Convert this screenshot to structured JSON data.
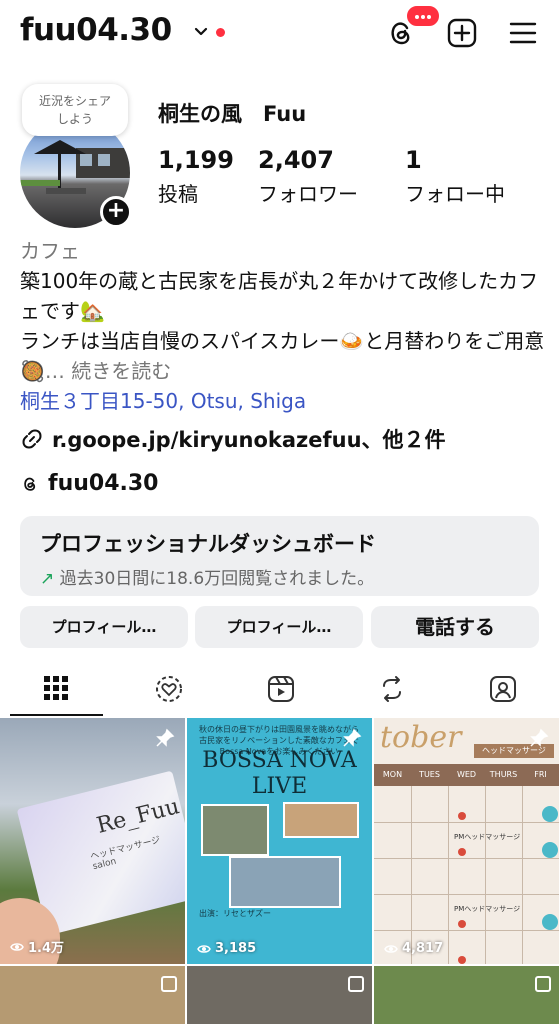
{
  "header": {
    "username": "fuu04.30",
    "icons": {
      "threads": "threads-icon",
      "create": "plus-square-icon",
      "menu": "hamburger-menu-icon"
    },
    "notification_badge": "•••"
  },
  "profile": {
    "note_bubble": "近況をシェア\nしよう",
    "display_name": "桐生の風　Fuu",
    "stats": [
      {
        "value": "1,199",
        "label": "投稿"
      },
      {
        "value": "2,407",
        "label": "フォロワー"
      },
      {
        "value": "1",
        "label": "フォロー中"
      }
    ],
    "category": "カフェ",
    "bio_line1": "築100年の蔵と古民家を店長が丸２年かけて改修したカフェです🏡",
    "bio_line2": "ランチは当店自慢のスパイスカレー🍛と月替わりをご用意🥘",
    "more": "… 続きを読む",
    "location": "桐生３丁目15-50, Otsu, Shiga",
    "link": "r.goope.jp/kiryunokazefuu、他２件",
    "threads_handle": "fuu04.30"
  },
  "dashboard": {
    "title": "プロフェッショナルダッシュボード",
    "subtitle_arrow": "↗",
    "subtitle": "過去30日間に18.6万回閲覧されました。"
  },
  "buttons": {
    "edit_profile": "プロフィール…",
    "share_profile": "プロフィール…",
    "call": "電話する"
  },
  "tabs": [
    "grid-icon",
    "reels-feed-icon",
    "reels-icon",
    "reposts-icon",
    "tagged-icon"
  ],
  "posts": [
    {
      "views": "1.4万",
      "pinned": true,
      "card_title": "Re_Fuu",
      "card_sub": "ヘッドマッサージsalon"
    },
    {
      "views": "3,185",
      "pinned": true,
      "title": "BOSSA NOVA\nLIVE",
      "top_text": "秋の休日の昼下がりは田園風景を眺めながら古民家をリノベーションした素敵なカフェでBossa Novaをお楽しみください",
      "bottom_text": "出演：リセとザズー"
    },
    {
      "views": "4,817",
      "pinned": true,
      "cal_title": "tober",
      "cal_tag": "ヘッドマッサージ",
      "days": [
        "MON",
        "TUES",
        "WED",
        "THURS",
        "FRI"
      ],
      "pm_label": "PMヘッドマッサージ"
    },
    {
      "multi": true
    },
    {
      "multi": true
    },
    {
      "multi": true
    }
  ]
}
